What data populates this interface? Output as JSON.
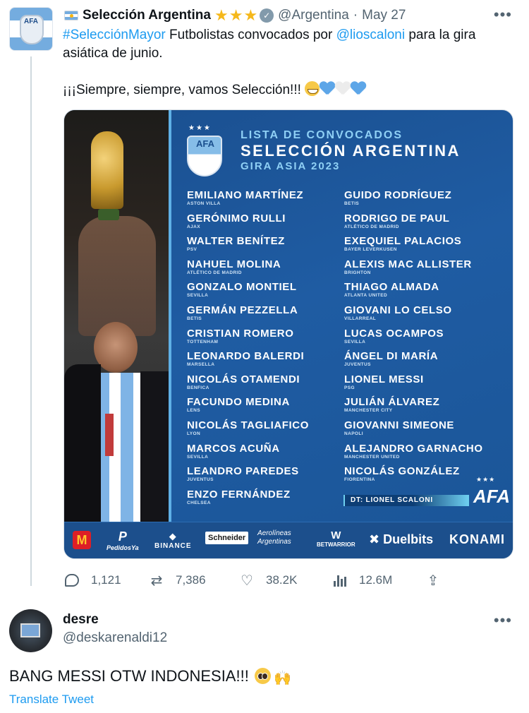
{
  "tweet": {
    "display_name": "Selección Argentina",
    "handle": "@Argentina",
    "separator": "·",
    "date": "May 27",
    "more": "•••",
    "text": {
      "hashtag": "#SelecciónMayor",
      "middle": " Futbolistas convocados por ",
      "mention": "@lioscaloni",
      "end": " para la gira asiática de junio.",
      "line2": "¡¡¡Siempre, siempre, vamos Selección!!! "
    },
    "stats": {
      "replies": "1,121",
      "retweets": "7,386",
      "likes": "38.2K",
      "views": "12.6M"
    }
  },
  "poster": {
    "crest_text": "AFA",
    "title1": "LISTA DE CONVOCADOS",
    "title2": "SELECCIÓN ARGENTINA",
    "title3": "GIRA ASIA 2023",
    "left_players": [
      {
        "name": "EMILIANO MARTÍNEZ",
        "club": "ASTON VILLA"
      },
      {
        "name": "GERÓNIMO RULLI",
        "club": "AJAX"
      },
      {
        "name": "WALTER BENÍTEZ",
        "club": "PSV"
      },
      {
        "name": "NAHUEL MOLINA",
        "club": "ATLÉTICO DE MADRID"
      },
      {
        "name": "GONZALO MONTIEL",
        "club": "SEVILLA"
      },
      {
        "name": "GERMÁN PEZZELLA",
        "club": "BETIS"
      },
      {
        "name": "CRISTIAN ROMERO",
        "club": "TOTTENHAM"
      },
      {
        "name": "LEONARDO BALERDI",
        "club": "MARSELLA"
      },
      {
        "name": "NICOLÁS OTAMENDI",
        "club": "BENFICA"
      },
      {
        "name": "FACUNDO MEDINA",
        "club": "LENS"
      },
      {
        "name": "NICOLÁS TAGLIAFICO",
        "club": "LYON"
      },
      {
        "name": "MARCOS ACUÑA",
        "club": "SEVILLA"
      },
      {
        "name": "LEANDRO PAREDES",
        "club": "JUVENTUS"
      },
      {
        "name": "ENZO FERNÁNDEZ",
        "club": "CHELSEA"
      }
    ],
    "right_players": [
      {
        "name": "GUIDO RODRÍGUEZ",
        "club": "BETIS"
      },
      {
        "name": "RODRIGO DE PAUL",
        "club": "ATLÉTICO DE MADRID"
      },
      {
        "name": "EXEQUIEL PALACIOS",
        "club": "BAYER LEVERKUSEN"
      },
      {
        "name": "ALEXIS MAC ALLISTER",
        "club": "BRIGHTON"
      },
      {
        "name": "THIAGO ALMADA",
        "club": "ATLANTA UNITED"
      },
      {
        "name": "GIOVANI LO CELSO",
        "club": "VILLARREAL"
      },
      {
        "name": "LUCAS OCAMPOS",
        "club": "SEVILLA"
      },
      {
        "name": "ÁNGEL DI MARÍA",
        "club": "JUVENTUS"
      },
      {
        "name": "LIONEL MESSI",
        "club": "PSG"
      },
      {
        "name": "JULIÁN ÁLVAREZ",
        "club": "MANCHESTER CITY"
      },
      {
        "name": "GIOVANNI SIMEONE",
        "club": "NAPOLI"
      },
      {
        "name": "ALEJANDRO GARNACHO",
        "club": "MANCHESTER UNITED"
      },
      {
        "name": "NICOLÁS GONZÁLEZ",
        "club": "FIORENTINA"
      }
    ],
    "coach": "DT: LIONEL SCALONI",
    "afa_logo": "AFA",
    "sponsors": {
      "mcdonalds": "M",
      "pedidosya_mark": "P",
      "pedidosya": "PedidosYa",
      "binance_mark": "◆",
      "binance": "BINANCE",
      "schneider": "Schneider",
      "aerolineas_1": "Aerolíneas",
      "aerolineas_2": "Argentinas",
      "betwarrior_mark": "W",
      "betwarrior": "BETWARRIOR",
      "duelbits": "✖ Duelbits",
      "konami": "KONAMI"
    }
  },
  "reply": {
    "display_name": "desre",
    "handle": "@deskarenaldi12",
    "more": "•••",
    "text": "BANG MESSI OTW INDONESIA!!! ",
    "translate": "Translate Tweet"
  },
  "colors": {
    "link": "#1d9bf0",
    "poster_blue": "#1f5ca3",
    "star_gold": "#f5b81b"
  },
  "icons": [
    "flag-argentina-icon",
    "star-icon",
    "verified-icon",
    "more-icon",
    "reply-icon",
    "retweet-icon",
    "like-icon",
    "views-icon",
    "share-icon"
  ]
}
